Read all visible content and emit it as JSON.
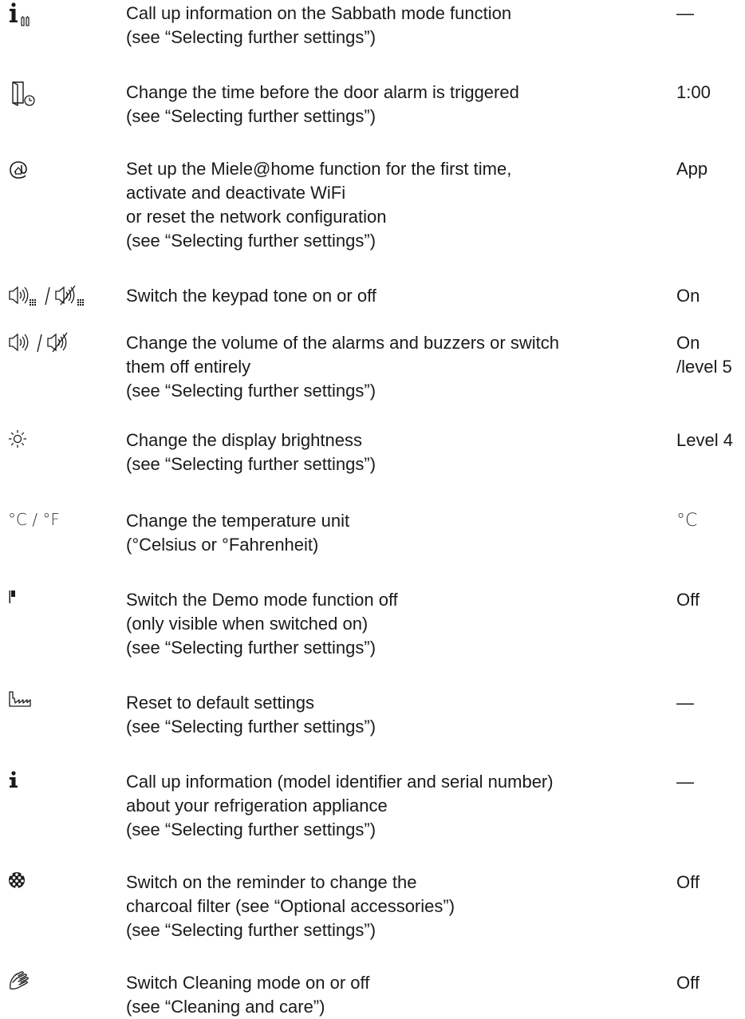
{
  "rows": [
    {
      "icon": "sabbath-info-icon",
      "lines": [
        "Call up information on the Sabbath mode function",
        "(see “Selecting further settings”)"
      ],
      "value": [
        "—"
      ]
    },
    {
      "icon": "door-alarm-timer-icon",
      "lines": [
        "Change the time before the door alarm is triggered",
        "(see “Selecting further settings”)"
      ],
      "value": [
        "1:00"
      ]
    },
    {
      "icon": "miele-at-home-icon",
      "lines": [
        "Set up the Miele@home function for the first time,",
        "activate and deactivate WiFi",
        "or reset the network configuration",
        "(see “Selecting further settings”)"
      ],
      "value": [
        "App"
      ]
    },
    {
      "icon": "keypad-tone-icon",
      "lines": [
        "Switch the keypad tone on or off"
      ],
      "value": [
        "On"
      ]
    },
    {
      "icon": "volume-icon",
      "lines": [
        "Change the volume of the alarms and buzzers or switch",
        "them off entirely",
        "(see “Selecting further settings”)"
      ],
      "value": [
        "On",
        "/level 5"
      ]
    },
    {
      "icon": "brightness-icon",
      "lines": [
        "Change the display brightness",
        "(see “Selecting further settings”)"
      ],
      "value": [
        "Level 4"
      ]
    },
    {
      "icon": "temperature-unit-icon",
      "icon_text": "°C / °F",
      "lines": [
        "Change the temperature unit",
        "(°Celsius or °Fahrenheit)"
      ],
      "value": [
        "°C"
      ]
    },
    {
      "icon": "demo-mode-icon",
      "lines": [
        "Switch the Demo mode function off",
        "(only visible when switched on)",
        "(see “Selecting further settings”)"
      ],
      "value": [
        "Off"
      ]
    },
    {
      "icon": "factory-reset-icon",
      "lines": [
        "Reset to default settings",
        "(see “Selecting further settings”)"
      ],
      "value": [
        "—"
      ]
    },
    {
      "icon": "info-icon",
      "lines": [
        "Call up information (model identifier and serial number)",
        "about your refrigeration appliance",
        "(see “Selecting further settings”)"
      ],
      "value": [
        "—"
      ]
    },
    {
      "icon": "charcoal-filter-icon",
      "lines": [
        "Switch on the reminder to change the",
        "charcoal filter (see “Optional accessories”)",
        "(see “Selecting further settings”)"
      ],
      "value": [
        "Off"
      ]
    },
    {
      "icon": "cleaning-mode-icon",
      "lines": [
        "Switch Cleaning mode on or off",
        "(see “Cleaning and care”)"
      ],
      "value": [
        "Off"
      ]
    }
  ]
}
